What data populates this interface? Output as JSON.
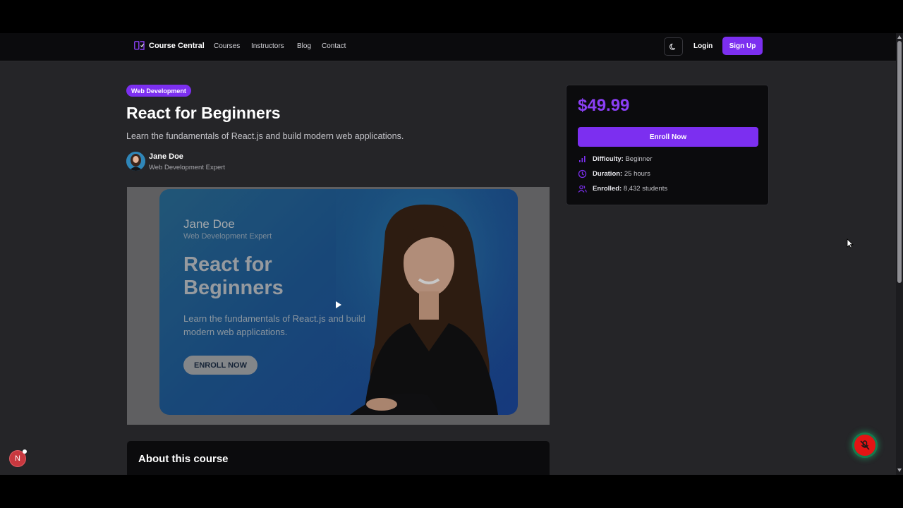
{
  "nav": {
    "brand": "Course Central",
    "links": [
      "Courses",
      "Instructors",
      "Blog",
      "Contact"
    ],
    "login": "Login",
    "signup": "Sign Up"
  },
  "course": {
    "category": "Web Development",
    "title": "React for Beginners",
    "subtitle": "Learn the fundamentals of React.js and build modern web applications.",
    "instructor": {
      "name": "Jane Doe",
      "role": "Web Development Expert"
    }
  },
  "video_thumbnail": {
    "name": "Jane Doe",
    "role": "Web Development Expert",
    "title": "React for Beginners",
    "description": "Learn the fundamentals of React.js and build modern web applications.",
    "cta": "ENROLL NOW"
  },
  "about": {
    "heading": "About this course"
  },
  "pricing": {
    "price": "$49.99",
    "enroll_label": "Enroll Now",
    "details": [
      {
        "label": "Difficulty:",
        "value": "Beginner",
        "icon": "bar-chart-icon"
      },
      {
        "label": "Duration:",
        "value": "25 hours",
        "icon": "clock-icon"
      },
      {
        "label": "Enrolled:",
        "value": "8,432 students",
        "icon": "users-icon"
      }
    ]
  },
  "misc": {
    "next_badge": "N"
  },
  "colors": {
    "accent": "#7c2ff0",
    "price": "#8b3ff5",
    "page_bg": "#252528",
    "nav_bg": "#0b0b0d"
  }
}
